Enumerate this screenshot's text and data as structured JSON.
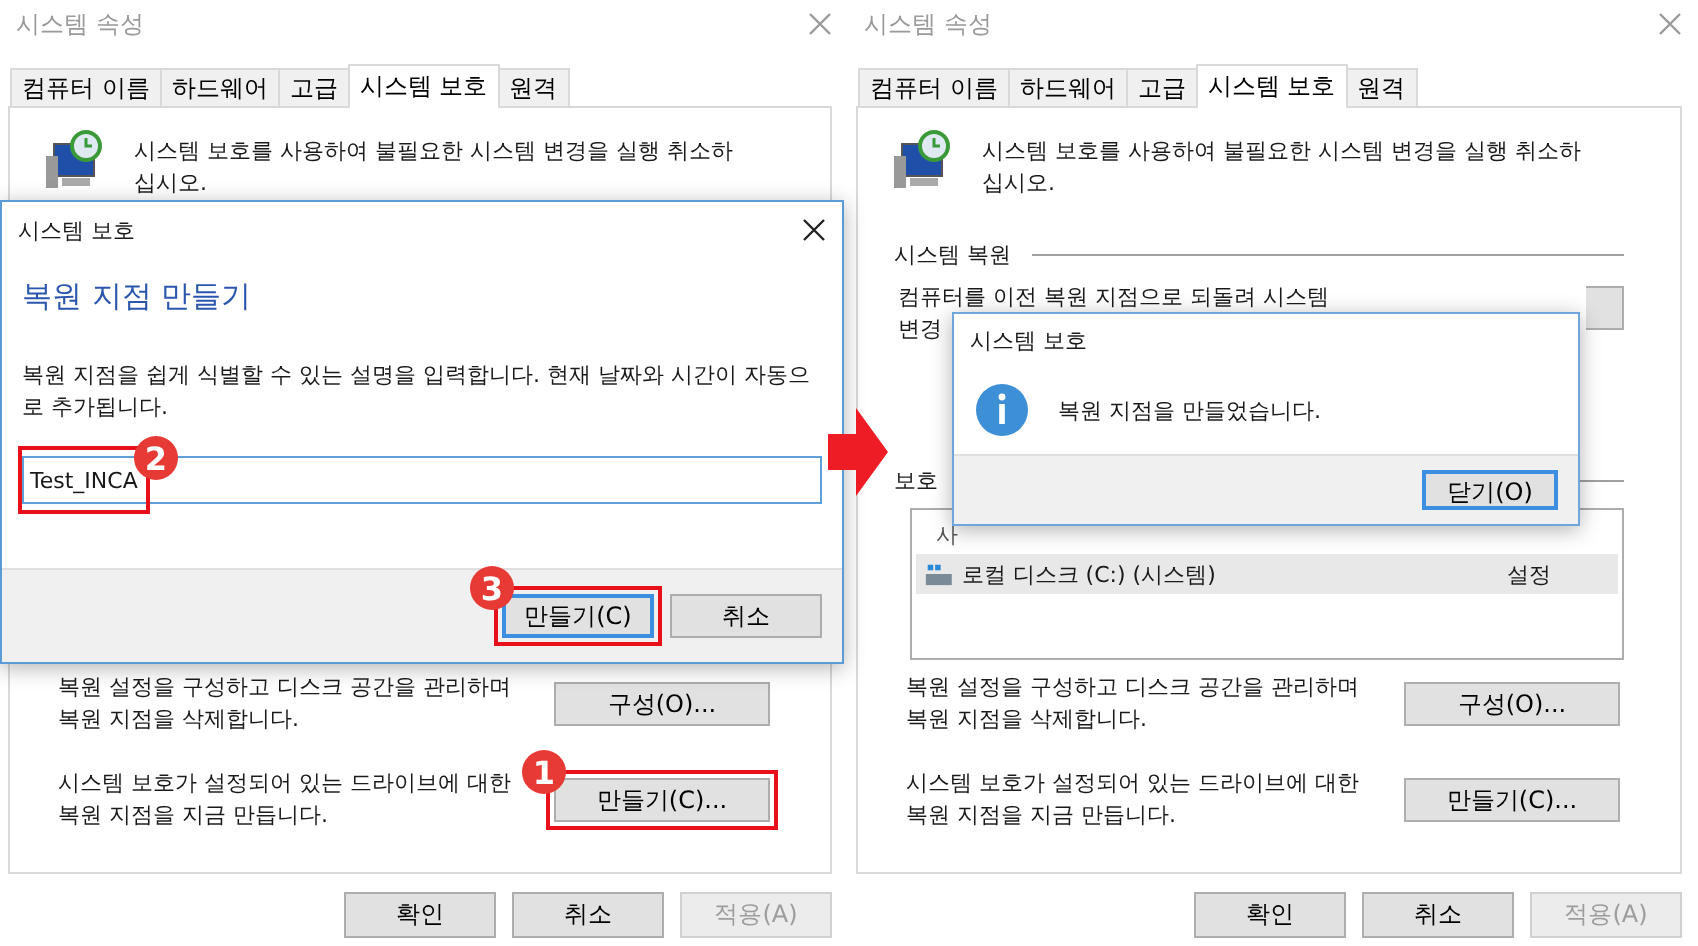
{
  "windows": [
    {
      "title": "시스템 속성",
      "active": false,
      "tabs": [
        {
          "label": "컴퓨터 이름",
          "selected": false
        },
        {
          "label": "하드웨어",
          "selected": false
        },
        {
          "label": "고급",
          "selected": false
        },
        {
          "label": "시스템 보호",
          "selected": true
        },
        {
          "label": "원격",
          "selected": false
        }
      ],
      "intro": "시스템 보호를 사용하여 불필요한 시스템 변경을 실행 취소하십시오.",
      "sections": [
        {
          "kind": "action",
          "text": "복원 설정을 구성하고 디스크 공간을 관리하며 복원 지점을 삭제합니다.",
          "button": {
            "label": "구성(O)..."
          }
        },
        {
          "kind": "action",
          "text": "시스템 보호가 설정되어 있는 드라이브에 대한 복원 지점을 지금 만듭니다.",
          "button": {
            "label": "만들기(C)...",
            "annotation": "1"
          }
        }
      ],
      "buttons": [
        {
          "label": "확인",
          "disabled": false
        },
        {
          "label": "취소",
          "disabled": false
        },
        {
          "label": "적용(A)",
          "disabled": true
        }
      ],
      "overlay": {
        "kind": "dialog",
        "title": "시스템 보호",
        "heading": "복원 지점 만들기",
        "description": "복원 지점을 쉽게 식별할 수 있는 설명을 입력합니다. 현재 날짜와 시간이 자동으로 추가됩니다.",
        "input": {
          "value": "Test_INCA",
          "annotation": "2"
        },
        "buttons": [
          {
            "label": "만들기(C)",
            "focused": true,
            "annotation": "3"
          },
          {
            "label": "취소",
            "focused": false
          }
        ]
      }
    },
    {
      "title": "시스템 속성",
      "active": false,
      "tabs": [
        {
          "label": "컴퓨터 이름",
          "selected": false
        },
        {
          "label": "하드웨어",
          "selected": false
        },
        {
          "label": "고급",
          "selected": false
        },
        {
          "label": "시스템 보호",
          "selected": true
        },
        {
          "label": "원격",
          "selected": false
        }
      ],
      "intro": "시스템 보호를 사용하여 불필요한 시스템 변경을 실행 취소하십시오.",
      "sections": [
        {
          "kind": "group",
          "label": "시스템 복원"
        },
        {
          "kind": "restore",
          "lines": [
            "컴퓨터를 이전 복원 지점으로 되돌려 시스템",
            "변경"
          ]
        },
        {
          "kind": "group",
          "label": "보호"
        },
        {
          "kind": "list",
          "columns": [
            "사"
          ],
          "rows": [
            {
              "cells": [
                "로컬 디스크 (C:) (시스템)",
                "설정"
              ],
              "selected": true
            }
          ]
        },
        {
          "kind": "action",
          "text": "복원 설정을 구성하고 디스크 공간을 관리하며 복원 지점을 삭제합니다.",
          "button": {
            "label": "구성(O)..."
          }
        },
        {
          "kind": "action",
          "text": "시스템 보호가 설정되어 있는 드라이브에 대한 복원 지점을 지금 만듭니다.",
          "button": {
            "label": "만들기(C)..."
          }
        }
      ],
      "buttons": [
        {
          "label": "확인",
          "disabled": false
        },
        {
          "label": "취소",
          "disabled": false
        },
        {
          "label": "적용(A)",
          "disabled": true
        }
      ],
      "overlay": {
        "kind": "message",
        "title": "시스템 보호",
        "message": "복원 지점을 만들었습니다.",
        "buttons": [
          {
            "label": "닫기(O)",
            "focused": true
          }
        ]
      }
    }
  ]
}
